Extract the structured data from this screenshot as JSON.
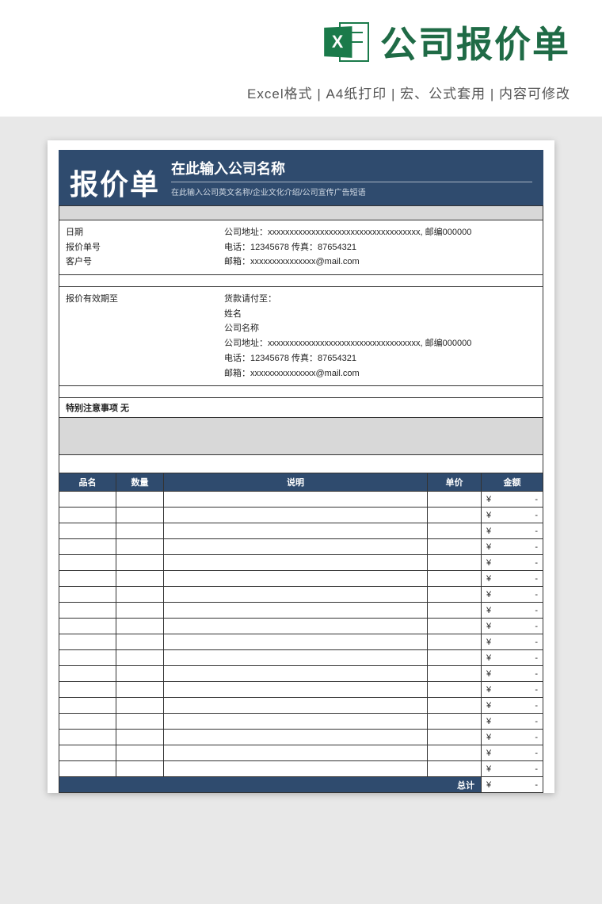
{
  "header": {
    "icon_letter": "X",
    "title": "公司报价单",
    "subtitle": "Excel格式 |  A4纸打印 | 宏、公式套用 | 内容可修改"
  },
  "doc": {
    "banner_title": "报价单",
    "company_name": "在此输入公司名称",
    "company_sub": "在此输入公司英文名称/企业文化介绍/公司宣传广告短语",
    "left": {
      "date_label": "日期",
      "quote_no_label": "报价单号",
      "customer_no_label": "客户号"
    },
    "right_company": {
      "address": "公司地址：xxxxxxxxxxxxxxxxxxxxxxxxxxxxxxxxxxx, 邮编000000",
      "tel_fax": "电话：12345678   传真：87654321",
      "email": "邮箱：xxxxxxxxxxxxxxx@mail.com"
    },
    "valid_until_label": "报价有效期至",
    "payee": {
      "title": "货款请付至：",
      "name": "姓名",
      "company": "公司名称",
      "address": "公司地址：xxxxxxxxxxxxxxxxxxxxxxxxxxxxxxxxxxx, 邮编000000",
      "tel_fax": "电话：12345678   传真：87654321",
      "email": "邮箱：xxxxxxxxxxxxxxx@mail.com"
    },
    "notes_label": "特别注意事项 无",
    "columns": {
      "name": "品名",
      "qty": "数量",
      "desc": "说明",
      "price": "单价",
      "amount": "金额"
    },
    "currency": "¥",
    "dash": "-",
    "row_count": 18,
    "total_label": "总计"
  }
}
